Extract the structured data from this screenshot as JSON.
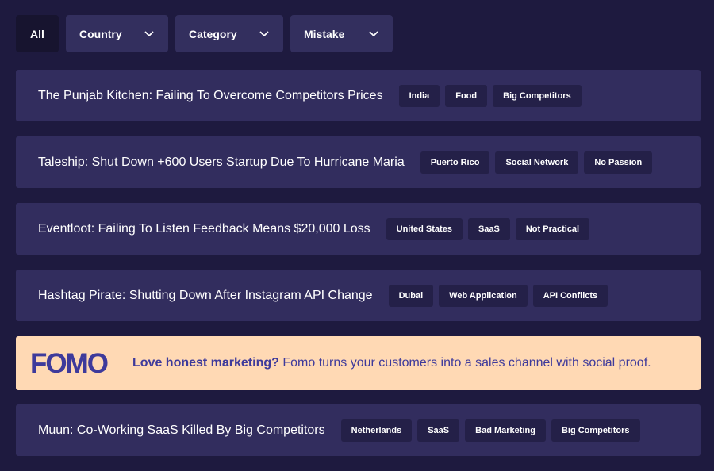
{
  "filters": {
    "all_label": "All",
    "country_label": "Country",
    "category_label": "Category",
    "mistake_label": "Mistake"
  },
  "rows": [
    {
      "title": "The Punjab Kitchen: Failing To Overcome Competitors Prices",
      "tags": [
        "India",
        "Food",
        "Big Competitors"
      ]
    },
    {
      "title": "Taleship: Shut Down +600 Users Startup Due To Hurricane Maria",
      "tags": [
        "Puerto Rico",
        "Social Network",
        "No Passion"
      ]
    },
    {
      "title": "Eventloot: Failing To Listen Feedback Means $20,000 Loss",
      "tags": [
        "United States",
        "SaaS",
        "Not Practical"
      ]
    },
    {
      "title": "Hashtag Pirate: Shutting Down After Instagram API Change",
      "tags": [
        "Dubai",
        "Web Application",
        "API Conflicts"
      ]
    },
    {
      "title": "Muun: Co-Working SaaS Killed By Big Competitors",
      "tags": [
        "Netherlands",
        "SaaS",
        "Bad Marketing",
        "Big Competitors"
      ]
    }
  ],
  "ad": {
    "logo_text": "FOMO",
    "headline": "Love honest marketing?",
    "body": " Fomo turns your customers into a sales channel with social proof."
  },
  "colors": {
    "background": "#1e1a3f",
    "card": "#322d5e",
    "tag": "#242048",
    "ad_background": "#ffd9b4",
    "ad_text": "#3e3a9b"
  }
}
